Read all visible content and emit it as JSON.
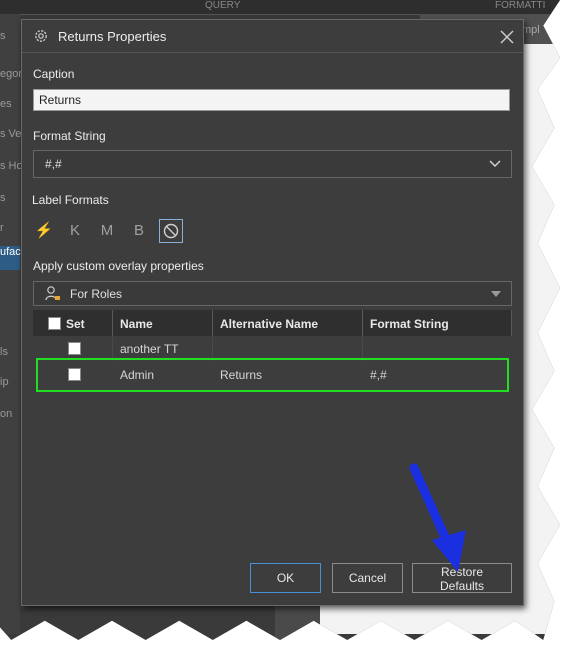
{
  "background": {
    "top_labels": [
      "QUERY",
      "FORMATTI"
    ],
    "left_items": [
      "s",
      "egor",
      "es",
      "s Ve",
      "s Ho",
      "s",
      "r",
      "ufac",
      "ls",
      "ip",
      "on"
    ],
    "right_header_text": "mpl"
  },
  "dialog": {
    "title": "Returns Properties",
    "caption_label": "Caption",
    "caption_value": "Returns",
    "format_label": "Format String",
    "format_value": "#,#",
    "label_formats_label": "Label Formats",
    "label_formats": [
      {
        "name": "auto",
        "glyph": "⚡"
      },
      {
        "name": "thousands",
        "glyph": "K"
      },
      {
        "name": "millions",
        "glyph": "M"
      },
      {
        "name": "billions",
        "glyph": "B"
      },
      {
        "name": "none",
        "glyph": "⃠"
      }
    ],
    "overlay_label": "Apply custom overlay properties",
    "roles_select_value": "For Roles",
    "grid": {
      "headers": [
        "Set",
        "Name",
        "Alternative Name",
        "Format String"
      ],
      "rows": [
        {
          "name": "another TT",
          "alt": "",
          "format": ""
        },
        {
          "name": "Admin",
          "alt": "Returns",
          "format": "#,#"
        }
      ]
    },
    "buttons": {
      "ok": "OK",
      "cancel": "Cancel",
      "restore": "Restore Defaults"
    }
  },
  "colors": {
    "dialog_bg": "#3d3d3d",
    "highlight": "#22dd22",
    "arrow": "#1a2fe0",
    "ok_border": "#4a90d9"
  }
}
